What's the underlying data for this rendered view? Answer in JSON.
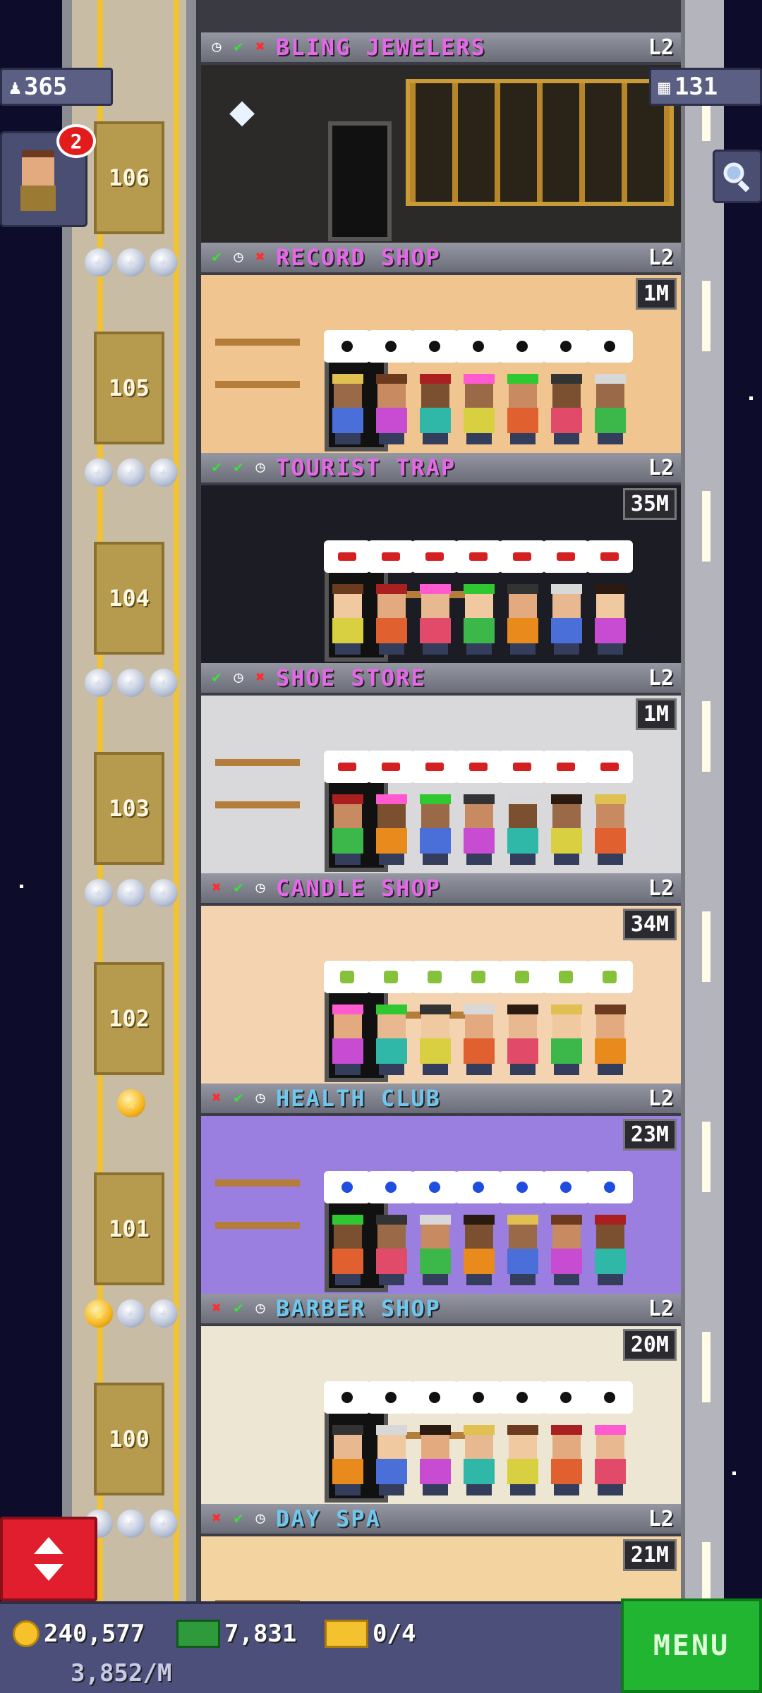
{
  "hud": {
    "population": "365",
    "floors_count": "131",
    "notification_count": "2"
  },
  "shaft_floors": [
    "106",
    "105",
    "104",
    "103",
    "102",
    "101",
    "100"
  ],
  "floors": [
    {
      "name": "BLING JEWELERS",
      "level": "L2",
      "stock": "",
      "status": [
        "clock",
        "ok",
        "no"
      ],
      "color": "#e667e8",
      "wall": "#2c2a28"
    },
    {
      "name": "RECORD SHOP",
      "level": "L2",
      "stock": "1M",
      "status": [
        "ok",
        "clock",
        "no"
      ],
      "color": "#e667e8",
      "wall": "#f1c58f"
    },
    {
      "name": "TOURIST TRAP",
      "level": "L2",
      "stock": "35M",
      "status": [
        "ok",
        "ok",
        "clock"
      ],
      "color": "#e667e8",
      "wall": "#1b1c24"
    },
    {
      "name": "SHOE STORE",
      "level": "L2",
      "stock": "1M",
      "status": [
        "ok",
        "clock",
        "no"
      ],
      "color": "#e667e8",
      "wall": "#d9d9db"
    },
    {
      "name": "CANDLE SHOP",
      "level": "L2",
      "stock": "34M",
      "status": [
        "no",
        "ok",
        "clock"
      ],
      "color": "#e667e8",
      "wall": "#f3d3b0"
    },
    {
      "name": "HEALTH CLUB",
      "level": "L2",
      "stock": "23M",
      "status": [
        "no",
        "ok",
        "clock"
      ],
      "color": "#6fc7ee",
      "wall": "#9b7fe0"
    },
    {
      "name": "BARBER SHOP",
      "level": "L2",
      "stock": "20M",
      "status": [
        "no",
        "ok",
        "clock"
      ],
      "color": "#6fc7ee",
      "wall": "#ece6d3"
    },
    {
      "name": "DAY SPA",
      "level": "L2",
      "stock": "21M",
      "status": [
        "no",
        "ok",
        "clock"
      ],
      "color": "#6fc7ee",
      "wall": "#f3d3a0"
    }
  ],
  "bottom": {
    "coins": "240,577",
    "bux": "7,831",
    "tickets": "0/4",
    "income": "3,852/M",
    "menu_label": "MENU"
  },
  "colors": {
    "accent_pink": "#e667e8",
    "accent_blue": "#6fc7ee",
    "menu_green": "#22b532",
    "elevator_red": "#e01e2e"
  }
}
